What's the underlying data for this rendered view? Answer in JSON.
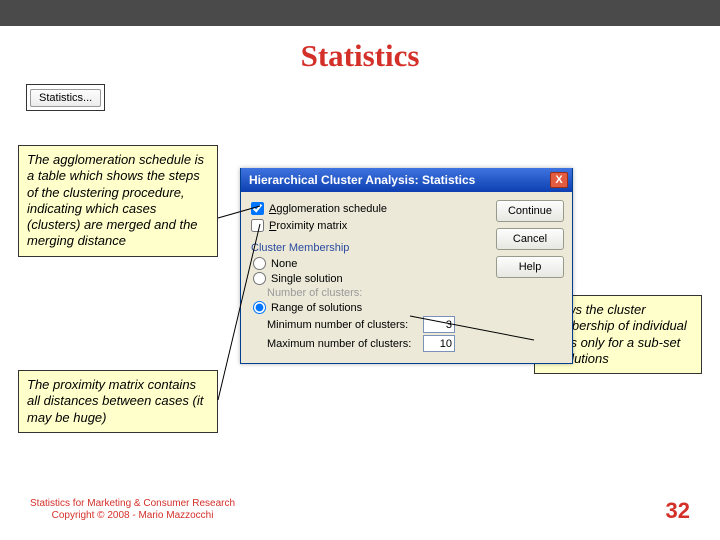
{
  "title": "Statistics",
  "stats_button_label": "Statistics...",
  "callout1": "The agglomeration schedule is a table which shows the steps of the clustering procedure, indicating which cases (clusters) are merged and the merging distance",
  "callout2": "The proximity matrix contains all distances between cases (it may be huge)",
  "callout3": "Shows the cluster membership of individual cases only for a sub-set of solutions",
  "dialog": {
    "title": "Hierarchical Cluster Analysis: Statistics",
    "agglom_label": "Agglomeration schedule",
    "proximity_label": "Proximity matrix",
    "group": "Cluster Membership",
    "none_label": "None",
    "single_label": "Single solution",
    "num_clusters_label": "Number of clusters:",
    "range_label": "Range of solutions",
    "min_label": "Minimum number of clusters:",
    "min_value": "3",
    "max_label": "Maximum number of clusters:",
    "max_value": "10",
    "continue": "Continue",
    "cancel": "Cancel",
    "help": "Help",
    "close_x": "X"
  },
  "footer": {
    "line1": "Statistics for Marketing & Consumer Research",
    "line2": "Copyright © 2008 - Mario Mazzocchi",
    "page": "32"
  }
}
